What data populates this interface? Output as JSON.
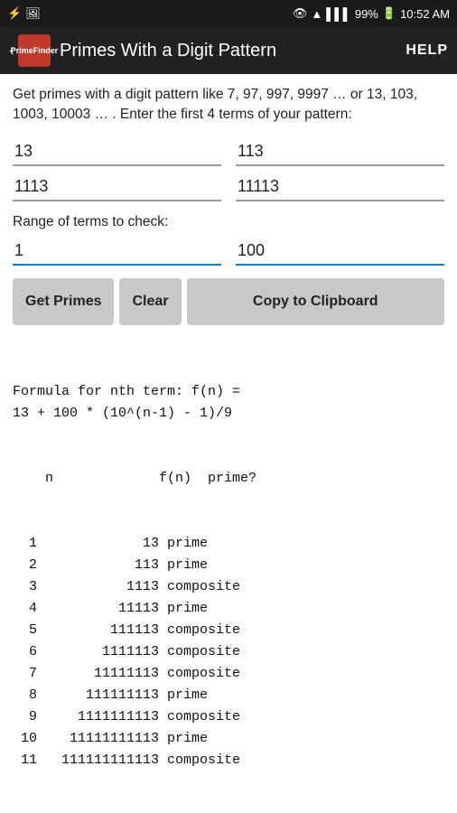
{
  "statusBar": {
    "icons": "usb camera eye wifi signal battery",
    "battery": "99%",
    "time": "10:52 AM"
  },
  "titleBar": {
    "backLabel": "‹",
    "logoLine1": "Prime",
    "logoLine2": "Finder",
    "title": "Primes With a Digit Pattern",
    "helpLabel": "HELP"
  },
  "description": "Get primes with a digit pattern like 7, 97, 997, 9997 … or 13, 103, 1003, 10003 … .\nEnter the first 4 terms of your pattern:",
  "inputs": {
    "term1": "13",
    "term2": "113",
    "term3": "1113",
    "term4": "11113"
  },
  "rangeLabel": "Range of terms to check:",
  "range": {
    "from": "1",
    "to": "100"
  },
  "buttons": {
    "getLabel": "Get Primes",
    "clearLabel": "Clear",
    "clipboardLabel": "Copy to Clipboard"
  },
  "formula": "Formula for nth term: f(n) =\n13 + 100 * (10^(n-1) - 1)/9",
  "tableHeader": "    n             f(n)  prime?",
  "rows": [
    {
      "n": "1",
      "fn": "13",
      "status": "prime"
    },
    {
      "n": "2",
      "fn": "113",
      "status": "prime"
    },
    {
      "n": "3",
      "fn": "1113",
      "status": "composite"
    },
    {
      "n": "4",
      "fn": "11113",
      "status": "prime"
    },
    {
      "n": "5",
      "fn": "111113",
      "status": "composite"
    },
    {
      "n": "6",
      "fn": "1111113",
      "status": "composite"
    },
    {
      "n": "7",
      "fn": "11111113",
      "status": "composite"
    },
    {
      "n": "8",
      "fn": "111111113",
      "status": "prime"
    },
    {
      "n": "9",
      "fn": "1111111113",
      "status": "composite"
    },
    {
      "n": "10",
      "fn": "11111111113",
      "status": "prime"
    },
    {
      "n": "11",
      "fn": "111111111113",
      "status": "composite"
    }
  ]
}
